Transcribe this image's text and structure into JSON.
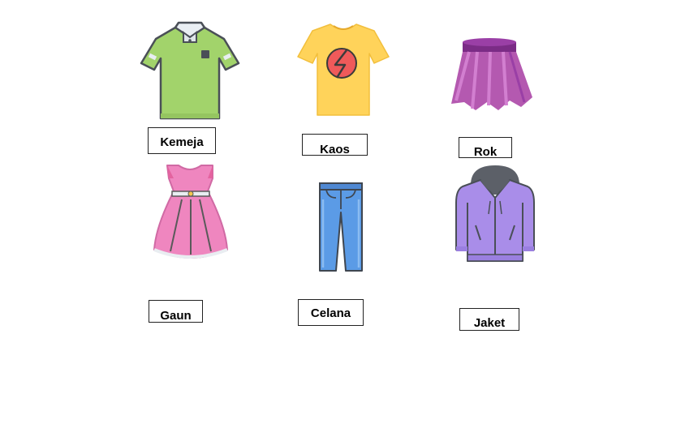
{
  "items": [
    {
      "label": "Kemeja",
      "icon": "polo-shirt-icon",
      "color": "#a2d36b"
    },
    {
      "label": "Kaos",
      "icon": "tshirt-icon",
      "color": "#ffd35a"
    },
    {
      "label": "Rok",
      "icon": "skirt-icon",
      "color": "#b459b0"
    },
    {
      "label": "Gaun",
      "icon": "dress-icon",
      "color": "#ef86bf"
    },
    {
      "label": "Celana",
      "icon": "jeans-icon",
      "color": "#5b9be6"
    },
    {
      "label": "Jaket",
      "icon": "jacket-icon",
      "color": "#a98de9"
    }
  ]
}
